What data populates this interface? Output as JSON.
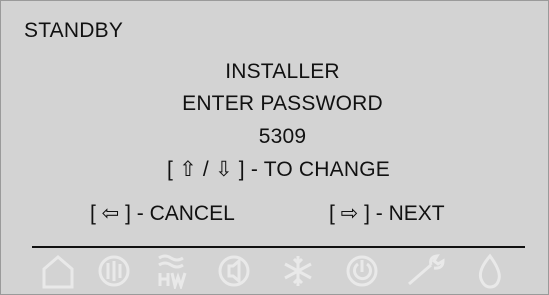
{
  "display": {
    "mode": "STANDBY",
    "menu_title": "INSTALLER",
    "prompt": "ENTER PASSWORD",
    "password_value": "5309",
    "change_hint": "[ ⇧ / ⇩ ] - TO CHANGE",
    "cancel_hint": "[ ⇦ ] - CANCEL",
    "next_hint": "[ ⇨ ] - NEXT"
  },
  "status_icons": [
    {
      "name": "home-icon"
    },
    {
      "name": "heating-zone-icon"
    },
    {
      "name": "hot-water-icon"
    },
    {
      "name": "speaker-icon"
    },
    {
      "name": "snowflake-icon"
    },
    {
      "name": "power-icon"
    },
    {
      "name": "wrench-icon"
    },
    {
      "name": "flame-icon"
    }
  ],
  "colors": {
    "screen_background": "#d3d3d3",
    "text": "#111111",
    "inactive_icon": "#e9e9e9"
  }
}
